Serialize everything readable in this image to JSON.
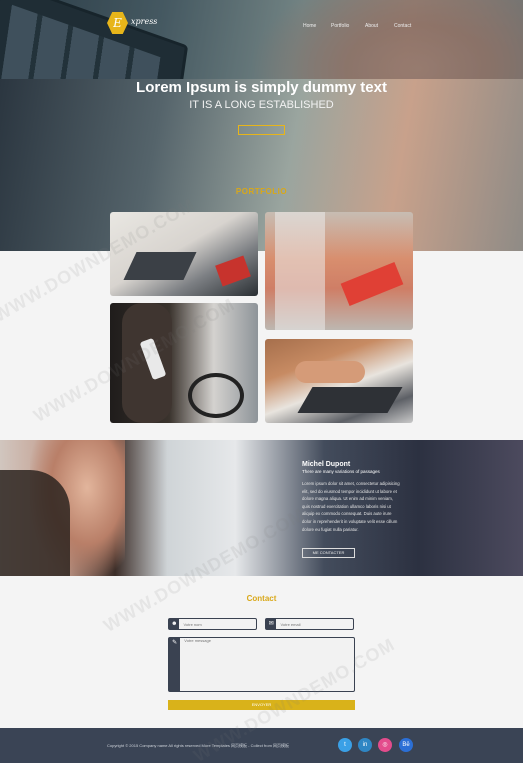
{
  "brand": {
    "logo_letter": "E",
    "logo_text": "xpress",
    "accent": "#e7b51a"
  },
  "nav": {
    "items": [
      {
        "label": "Home"
      },
      {
        "label": "Portfolio"
      },
      {
        "label": "About"
      },
      {
        "label": "Contact"
      }
    ]
  },
  "hero": {
    "title": "Lorem Ipsum is simply dummy text",
    "subtitle": "IT IS A LONG ESTABLISHED",
    "button_label": ""
  },
  "portfolio": {
    "title": "PORTFOLIO"
  },
  "about": {
    "name": "Michel Dupont",
    "role": "There are many variations of passages",
    "body": "Lorem ipsum dolor sit amet, consectetur adipisicing elit, sed do eiusmod tempor incididunt ut labore et dolore magna aliqua. Ut enim ad minim veniam, quis nostrud exercitation ullamco laboris nisi ut aliquip ex commodo consequat. Duis aute irure dolor in reprehenderit in voluptate velit esse cillum dolore eu fugiat nulla pariatur.",
    "button_label": "ME CONTACTER"
  },
  "contact": {
    "title": "Contact",
    "name_placeholder": "Votre nom",
    "email_placeholder": "Votre email",
    "message_placeholder": "Votre message",
    "submit_label": "ENVOYER"
  },
  "footer": {
    "copyright": "Copyright © 2015 Company name All rights reserved More Templates 网页模板 - Collect from 网页模板",
    "social": [
      {
        "icon": "twitter-icon",
        "glyph": "t",
        "color": "#3aa0e6"
      },
      {
        "icon": "linkedin-icon",
        "glyph": "in",
        "color": "#2f86c4"
      },
      {
        "icon": "dribbble-icon",
        "glyph": "◎",
        "color": "#e34c8c"
      },
      {
        "icon": "behance-icon",
        "glyph": "Bē",
        "color": "#2b6fd6"
      }
    ]
  },
  "watermark": {
    "text": "WWW.DOWNDEMO.COM"
  }
}
